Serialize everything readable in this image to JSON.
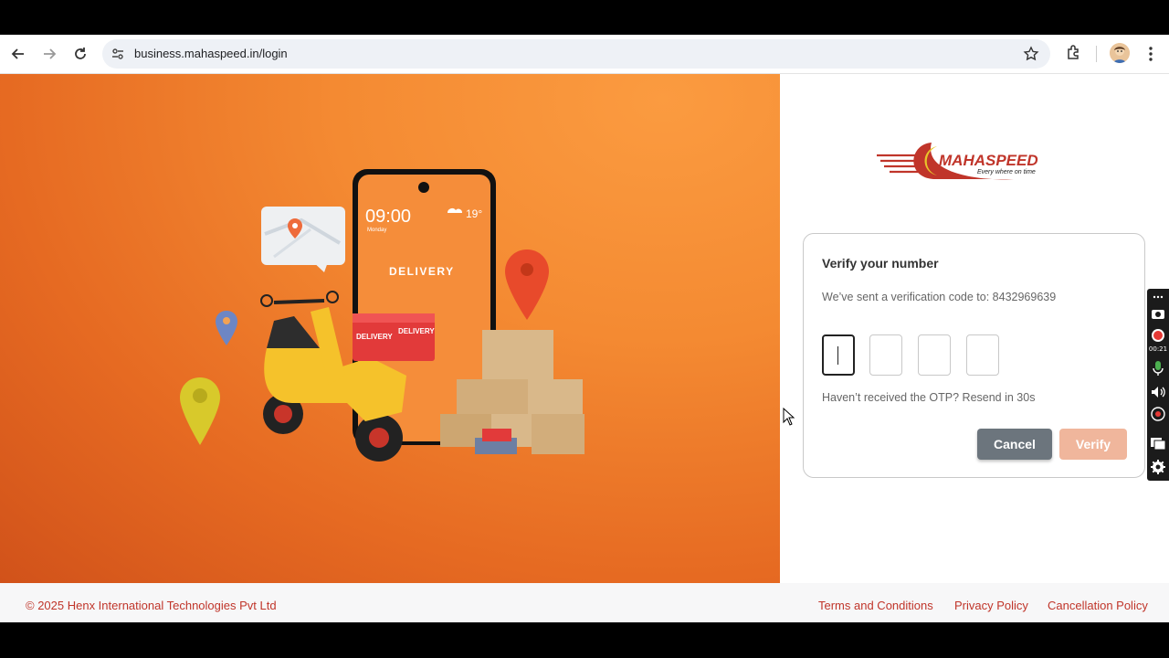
{
  "browser": {
    "url": "business.mahaspeed.in/login"
  },
  "hero": {
    "phone_time": "09:00",
    "phone_day": "Monday",
    "phone_temp": "19°",
    "phone_label": "DELIVERY",
    "box_label": "DELIVERY"
  },
  "logo": {
    "name": "MAHASPEED",
    "tagline": "Every where on time"
  },
  "verify": {
    "title": "Verify your number",
    "subtitle": "We’ve sent a verification code to: 8432969639",
    "resend": "Haven’t received the OTP? Resend in 30s",
    "cancel_label": "Cancel",
    "verify_label": "Verify",
    "otp_values": [
      "",
      "",
      "",
      ""
    ]
  },
  "footer": {
    "copyright": "© 2025 Henx International Technologies Pvt Ltd",
    "terms": "Terms and Conditions",
    "privacy": "Privacy Policy",
    "cancellation": "Cancellation Policy"
  },
  "recorder": {
    "time": "00:21"
  },
  "colors": {
    "brand_red": "#c0352a",
    "hero_orange": "#f48a32",
    "cancel_gray": "#6c757d",
    "verify_disabled": "#f0b69c"
  }
}
